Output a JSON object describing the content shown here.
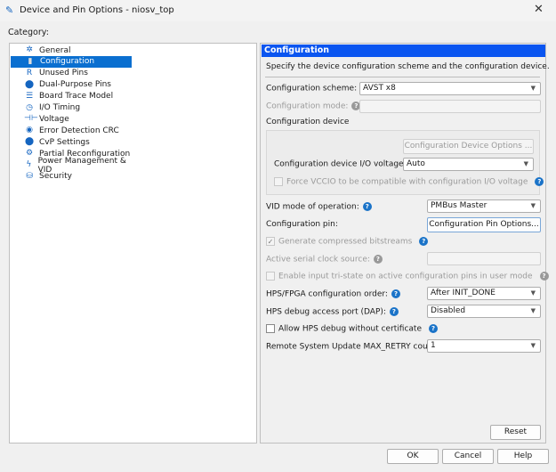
{
  "window": {
    "title": "Device and Pin Options - niosv_top",
    "close": "✕"
  },
  "category_label": "Category:",
  "tree": [
    {
      "label": "General",
      "icon": "general-icon",
      "glyph": "✲"
    },
    {
      "label": "Configuration",
      "icon": "configuration-icon",
      "glyph": "▮",
      "selected": true
    },
    {
      "label": "Unused Pins",
      "icon": "unused-pins-icon",
      "glyph": "R"
    },
    {
      "label": "Dual-Purpose Pins",
      "icon": "dual-purpose-pins-icon",
      "glyph": "⬤"
    },
    {
      "label": "Board Trace Model",
      "icon": "board-trace-icon",
      "glyph": "☰"
    },
    {
      "label": "I/O Timing",
      "icon": "clock-icon",
      "glyph": "◷"
    },
    {
      "label": "Voltage",
      "icon": "voltage-icon",
      "glyph": "⊣⊢"
    },
    {
      "label": "Error Detection CRC",
      "icon": "crc-icon",
      "glyph": "◉"
    },
    {
      "label": "CvP Settings",
      "icon": "cvp-icon",
      "glyph": "⬤"
    },
    {
      "label": "Partial Reconfiguration",
      "icon": "partial-reconfig-icon",
      "glyph": "⚙"
    },
    {
      "label": "Power Management & VID",
      "icon": "power-icon",
      "glyph": "ϟ"
    },
    {
      "label": "Security",
      "icon": "security-icon",
      "glyph": "⛁"
    }
  ],
  "panel": {
    "header": "Configuration",
    "description": "Specify the device configuration scheme and the configuration device.",
    "scheme_label": "Configuration scheme:",
    "scheme_value": "AVST x8",
    "mode_label": "Configuration mode:",
    "mode_value": "",
    "device_group": "Configuration device",
    "device_options_button": "Configuration Device Options ...",
    "io_voltage_label": "Configuration device I/O voltage:",
    "io_voltage_value": "Auto",
    "force_vccio_label": "Force VCCIO to be compatible with configuration I/O voltage",
    "vid_label": "VID mode of operation:",
    "vid_value": "PMBus Master",
    "pin_label": "Configuration pin:",
    "pin_button": "Configuration Pin Options...",
    "compressed_label": "Generate compressed bitstreams",
    "compressed_checked": true,
    "serial_clock_label": "Active serial clock source:",
    "serial_clock_value": "",
    "tristate_label": "Enable input tri-state on active configuration pins in user mode",
    "hps_order_label": "HPS/FPGA configuration order:",
    "hps_order_value": "After INIT_DONE",
    "dap_label": "HPS debug access port (DAP):",
    "dap_value": "Disabled",
    "allow_debug_label": "Allow HPS debug without certificate",
    "retry_label": "Remote System Update MAX_RETRY count",
    "retry_value": "1",
    "reset_button": "Reset"
  },
  "footer": {
    "ok": "OK",
    "cancel": "Cancel",
    "help": "Help"
  },
  "help_glyph": "?",
  "check_glyph": "✓",
  "arrow_glyph": "▼"
}
